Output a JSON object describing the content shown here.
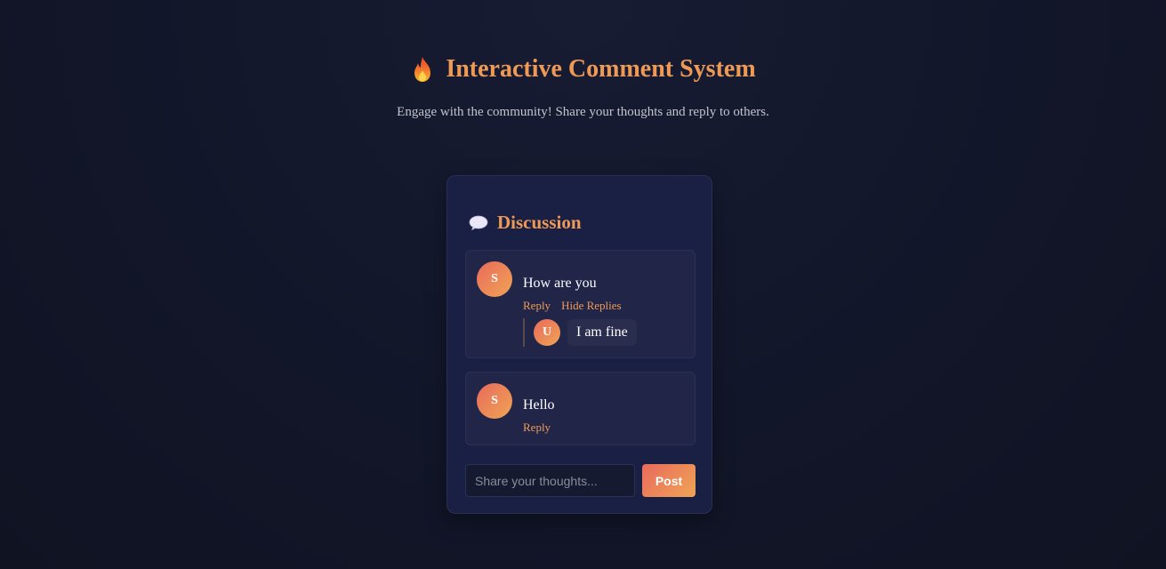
{
  "header": {
    "title": "Interactive Comment System",
    "subtitle": "Engage with the community! Share your thoughts and reply to others.",
    "icon": "fire-icon"
  },
  "discussion": {
    "title": "Discussion",
    "icon": "speech-bubble-icon",
    "comments": [
      {
        "avatar": "S",
        "text": "How are you",
        "reply_label": "Reply",
        "toggle_label": "Hide Replies",
        "replies": [
          {
            "avatar": "U",
            "text": "I am fine"
          }
        ]
      },
      {
        "avatar": "S",
        "text": "Hello",
        "reply_label": "Reply"
      }
    ],
    "input": {
      "placeholder": "Share your thoughts...",
      "value": ""
    },
    "post_label": "Post"
  },
  "colors": {
    "accent": "#ee9a56",
    "gradient_start": "#e86a5c",
    "gradient_end": "#f0a455",
    "card_bg": "#1a1f44",
    "page_bg": "#121629"
  }
}
